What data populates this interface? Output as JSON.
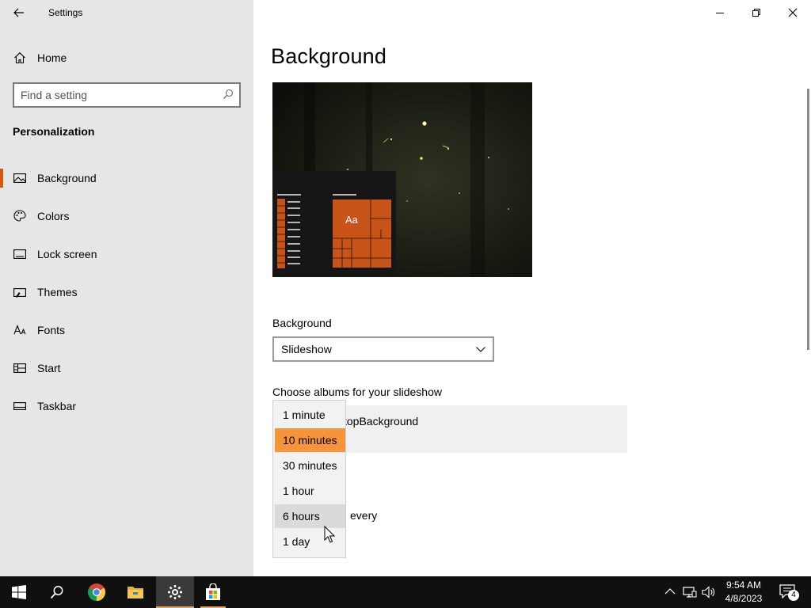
{
  "window": {
    "title": "Settings"
  },
  "sidebar": {
    "home_label": "Home",
    "search_placeholder": "Find a setting",
    "section": "Personalization",
    "items": [
      {
        "label": "Background",
        "icon": "picture-icon",
        "active": true
      },
      {
        "label": "Colors",
        "icon": "palette-icon"
      },
      {
        "label": "Lock screen",
        "icon": "lock-screen-icon"
      },
      {
        "label": "Themes",
        "icon": "brush-icon"
      },
      {
        "label": "Fonts",
        "icon": "font-icon"
      },
      {
        "label": "Start",
        "icon": "start-grid-icon"
      },
      {
        "label": "Taskbar",
        "icon": "taskbar-icon"
      }
    ]
  },
  "main": {
    "title": "Background",
    "preview": {
      "tile_label": "Aa"
    },
    "background_label": "Background",
    "background_value": "Slideshow",
    "albums_label": "Choose albums for your slideshow",
    "album_name_visible": "topBackground",
    "change_every_visible": "every"
  },
  "dropdown": {
    "options": [
      "1 minute",
      "10 minutes",
      "30 minutes",
      "1 hour",
      "6 hours",
      "1 day"
    ],
    "selected": "10 minutes",
    "hovered": "6 hours"
  },
  "taskbar": {
    "apps": [
      "start-icon",
      "search-icon",
      "chrome-icon",
      "file-explorer-icon",
      "settings-icon",
      "store-icon"
    ],
    "active_app": "settings-icon",
    "time": "9:54 AM",
    "date": "4/8/2023",
    "notification_count": "4"
  },
  "colors": {
    "accent": "#d05a11",
    "dropdown_selected": "#f7943a",
    "sidebar_bg": "#e6e6e6",
    "taskbar_bg": "#101010"
  }
}
